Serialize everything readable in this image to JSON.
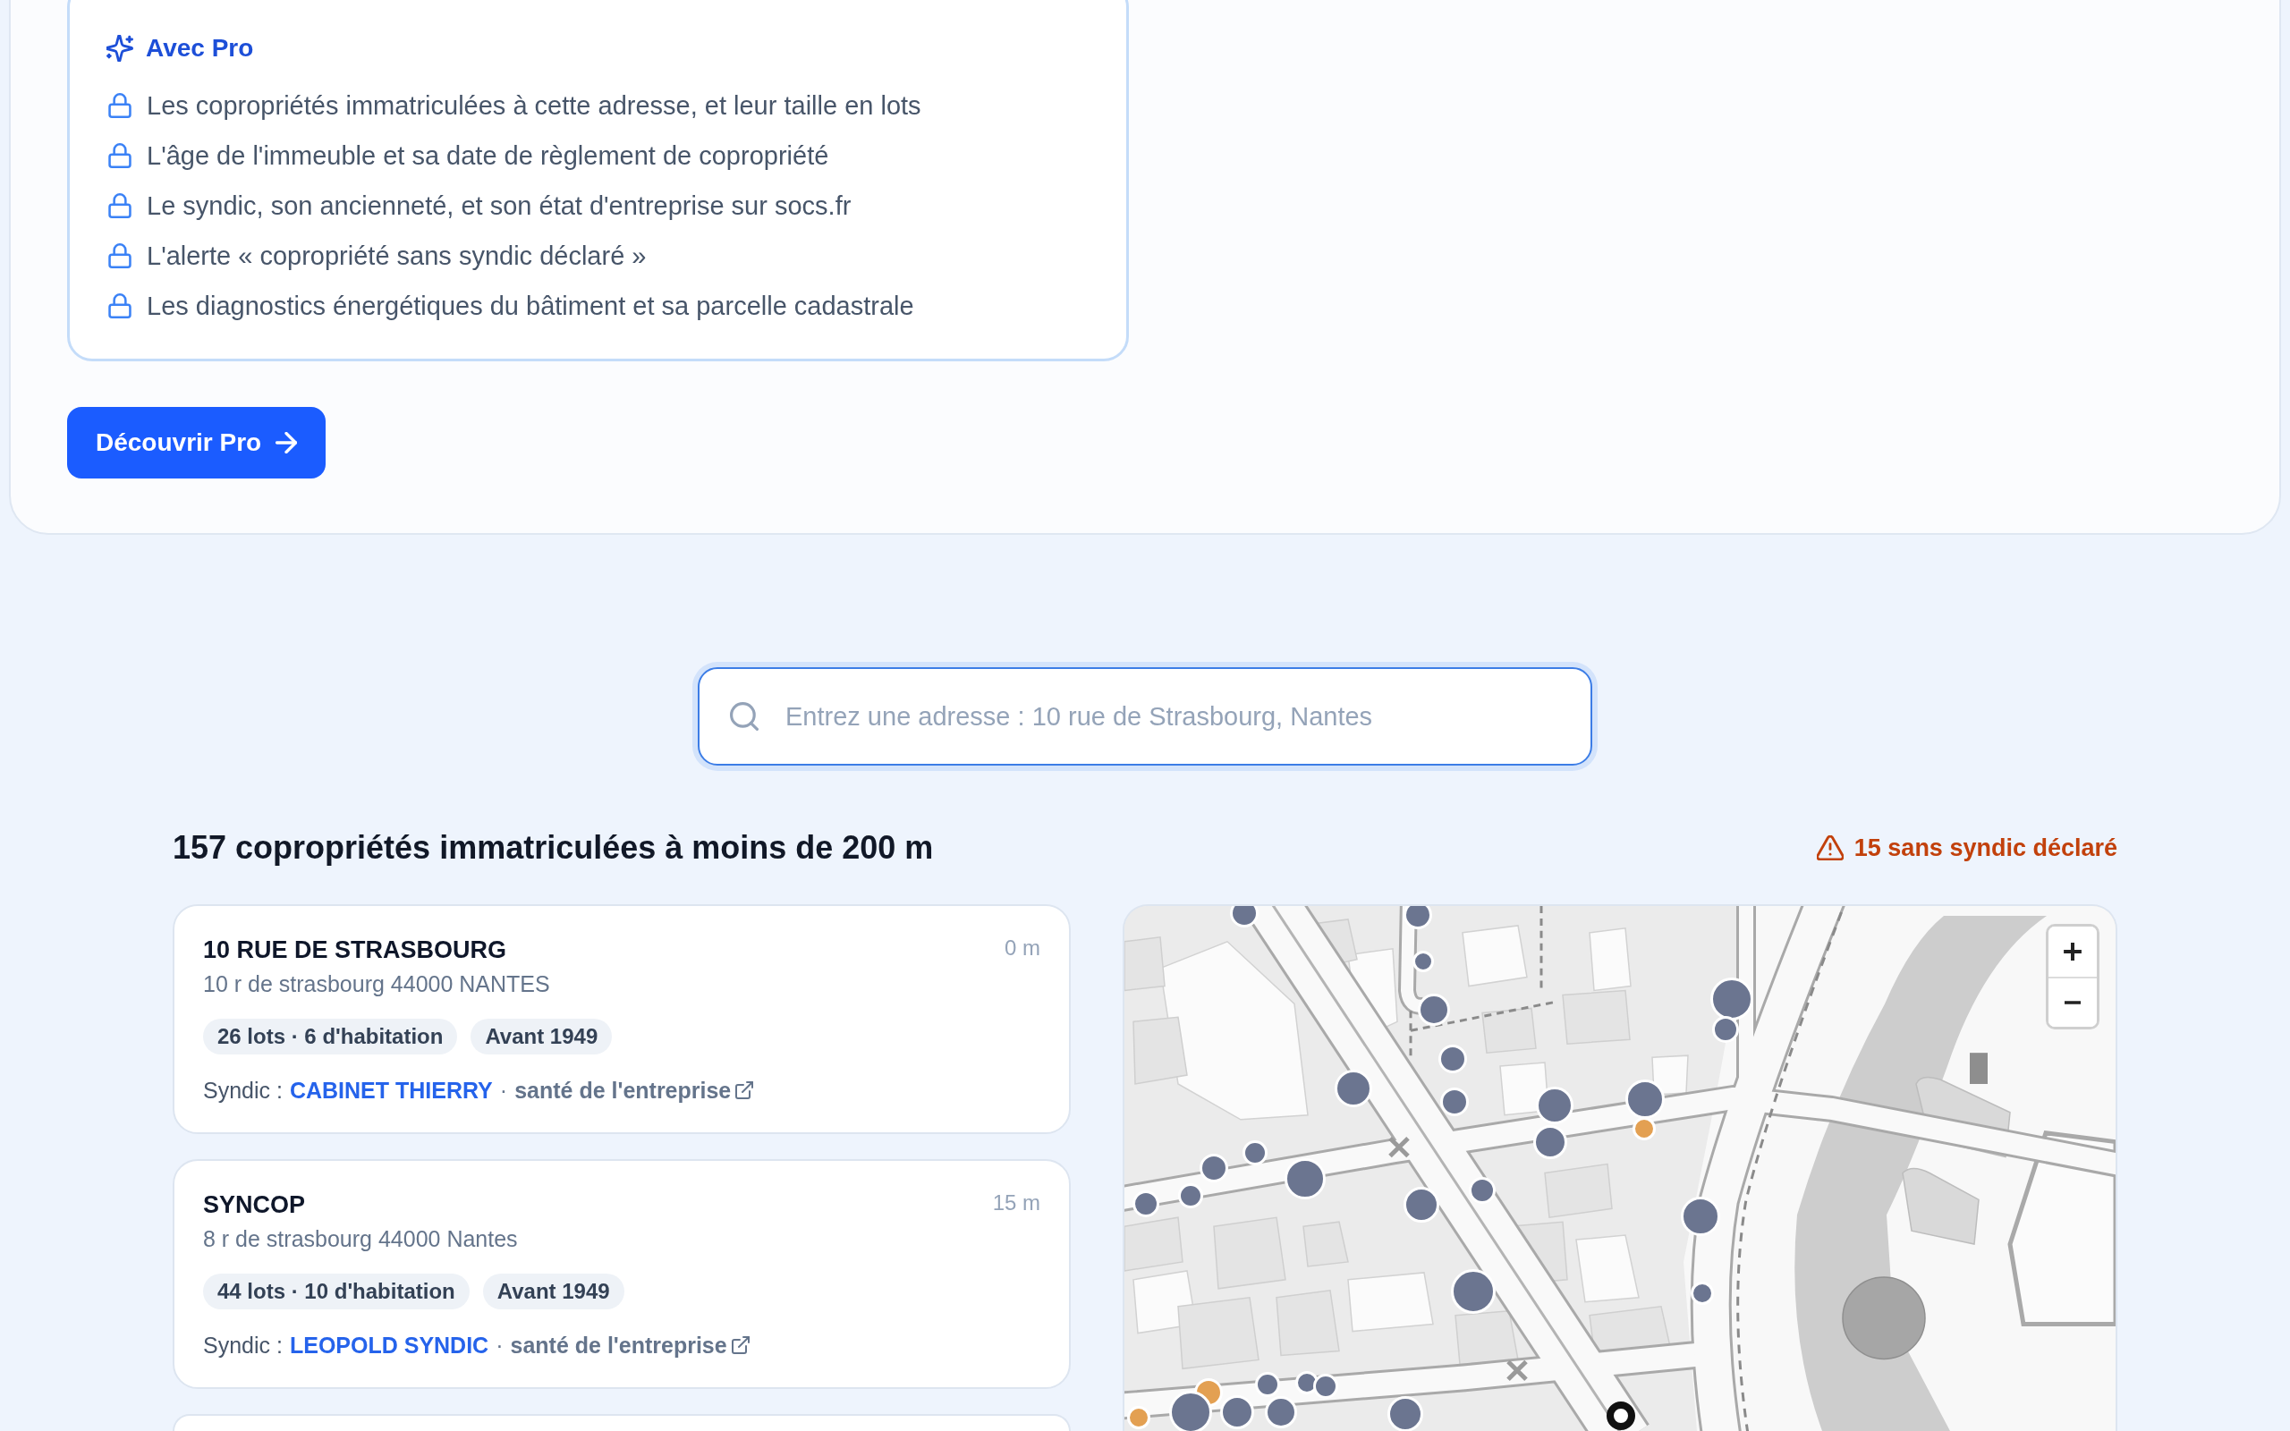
{
  "pro_box": {
    "title": "Avec Pro",
    "features": [
      "Les copropriétés immatriculées à cette adresse, et leur taille en lots",
      "L'âge de l'immeuble et sa date de règlement de copropriété",
      "Le syndic, son ancienneté, et son état d'entreprise sur socs.fr",
      "L'alerte « copropriété sans syndic déclaré »",
      "Les diagnostics énergétiques du bâtiment et sa parcelle cadastrale"
    ]
  },
  "cta_button": {
    "label": "Découvrir Pro"
  },
  "search": {
    "placeholder": "Entrez une adresse : 10 rue de Strasbourg, Nantes"
  },
  "results": {
    "heading": "157 copropriétés immatriculées à moins de 200 m",
    "alert": "15 sans syndic déclaré",
    "listings": [
      {
        "name": "10 RUE DE STRASBOURG",
        "distance": "0 m",
        "address": "10 r de strasbourg 44000 NANTES",
        "tags": [
          "26 lots · 6 d'habitation",
          "Avant 1949"
        ],
        "syndic_label": "Syndic :",
        "syndic": "CABINET THIERRY",
        "separator": "·",
        "health_link": "santé de l'entreprise"
      },
      {
        "name": "SYNCOP",
        "distance": "15 m",
        "address": "8 r de strasbourg 44000 Nantes",
        "tags": [
          "44 lots · 10 d'habitation",
          "Avant 1949"
        ],
        "syndic_label": "Syndic :",
        "syndic": "LEOPOLD SYNDIC",
        "separator": "·",
        "health_link": "santé de l'entreprise"
      }
    ]
  },
  "map": {
    "markers": [
      {
        "kind": "dot",
        "color": "#6b7590"
      },
      {
        "kind": "dot",
        "color": "#6b7590"
      },
      {
        "kind": "dot",
        "color": "#6b7590"
      },
      {
        "kind": "dot",
        "color": "#6b7590"
      },
      {
        "kind": "dot",
        "color": "#6b7590"
      },
      {
        "kind": "dot",
        "color": "#6b7590"
      },
      {
        "kind": "dot",
        "color": "#6b7590"
      },
      {
        "kind": "dot",
        "color": "#6b7590"
      },
      {
        "kind": "dot",
        "color": "#6b7590"
      },
      {
        "kind": "dot",
        "color": "#6b7590"
      },
      {
        "kind": "dot",
        "color": "#e3a052"
      },
      {
        "kind": "dot",
        "color": "#6b7590"
      },
      {
        "kind": "dot",
        "color": "#6b7590"
      },
      {
        "kind": "dot",
        "color": "#6b7590"
      },
      {
        "kind": "dot",
        "color": "#6b7590"
      },
      {
        "kind": "dot",
        "color": "#6b7590"
      },
      {
        "kind": "dot",
        "color": "#6b7590"
      },
      {
        "kind": "dot",
        "color": "#6b7590"
      },
      {
        "kind": "dot",
        "color": "#6b7590"
      },
      {
        "kind": "dot",
        "color": "#6b7590"
      },
      {
        "kind": "dot",
        "color": "#6b7590"
      },
      {
        "kind": "dot",
        "color": "#6b7590"
      },
      {
        "kind": "dot",
        "color": "#6b7590"
      },
      {
        "kind": "dot",
        "color": "#6b7590"
      },
      {
        "kind": "dot",
        "color": "#6b7590"
      },
      {
        "kind": "dot",
        "color": "#6b7590"
      },
      {
        "kind": "dot",
        "color": "#e3a052"
      },
      {
        "kind": "dot",
        "color": "#6b7590"
      },
      {
        "kind": "dot",
        "color": "#6b7590"
      },
      {
        "kind": "dot",
        "color": "#6b7590"
      },
      {
        "kind": "dot",
        "color": "#6b7590"
      },
      {
        "kind": "dot",
        "color": "#e3a052"
      },
      {
        "kind": "target",
        "color": "#111111"
      }
    ]
  }
}
